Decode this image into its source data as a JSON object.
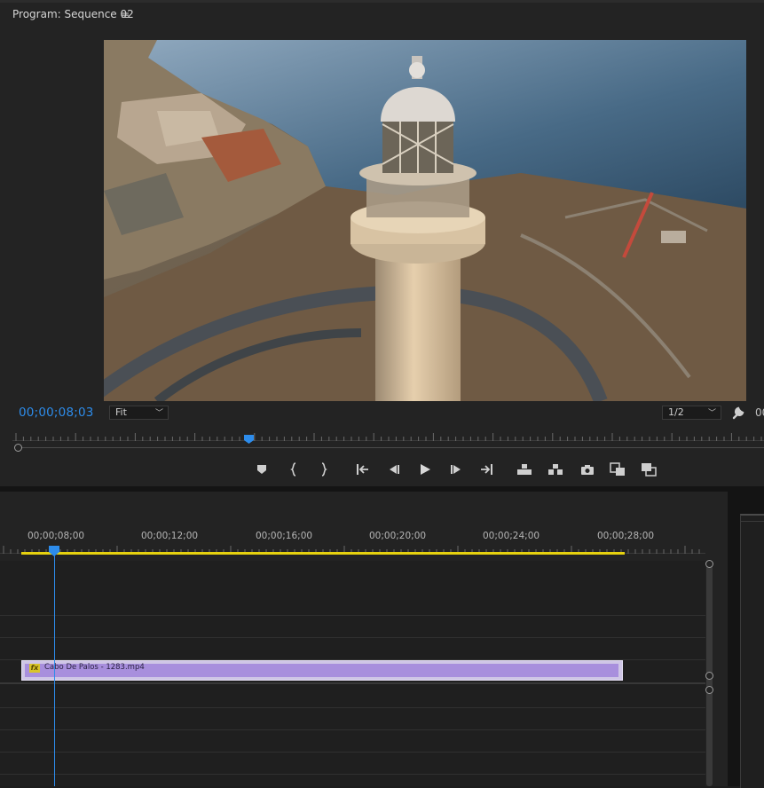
{
  "program_monitor": {
    "title": "Program: Sequence 02",
    "menu_icon": "hamburger-menu-icon",
    "timecode": "00;00;08;03",
    "fit_dropdown": {
      "selected": "Fit"
    },
    "resolution_dropdown": {
      "selected": "1/2"
    },
    "settings_icon": "wrench-icon",
    "duration_cut": "00",
    "playhead_position": 0.315,
    "transport": [
      {
        "name": "add-marker-button",
        "icon": "marker-icon"
      },
      {
        "name": "mark-in-button",
        "icon": "mark-in-icon"
      },
      {
        "name": "mark-out-button",
        "icon": "mark-out-icon"
      },
      {
        "name": "go-to-in-button",
        "icon": "go-to-in-icon"
      },
      {
        "name": "step-back-button",
        "icon": "step-back-icon"
      },
      {
        "name": "play-button",
        "icon": "play-icon"
      },
      {
        "name": "step-forward-button",
        "icon": "step-forward-icon"
      },
      {
        "name": "go-to-out-button",
        "icon": "go-to-out-icon"
      },
      {
        "name": "lift-button",
        "icon": "lift-icon"
      },
      {
        "name": "extract-button",
        "icon": "extract-icon"
      },
      {
        "name": "export-frame-button",
        "icon": "camera-icon"
      },
      {
        "name": "comparison-view-button",
        "icon": "comparison-view-icon"
      },
      {
        "name": "toggle-proxies-button",
        "icon": "proxy-icon"
      }
    ]
  },
  "timeline": {
    "ruler_labels": [
      "00;00;08;00",
      "00;00;12;00",
      "00;00;16;00",
      "00;00;20;00",
      "00;00;24;00",
      "00;00;28;00"
    ],
    "clip": {
      "name": "Cabo De Palos - 1283.mp4",
      "fx_badge": "fx",
      "color": "#a88fdd"
    },
    "work_area_color": "#e6d10f",
    "playhead_color": "#2d8ceb"
  }
}
